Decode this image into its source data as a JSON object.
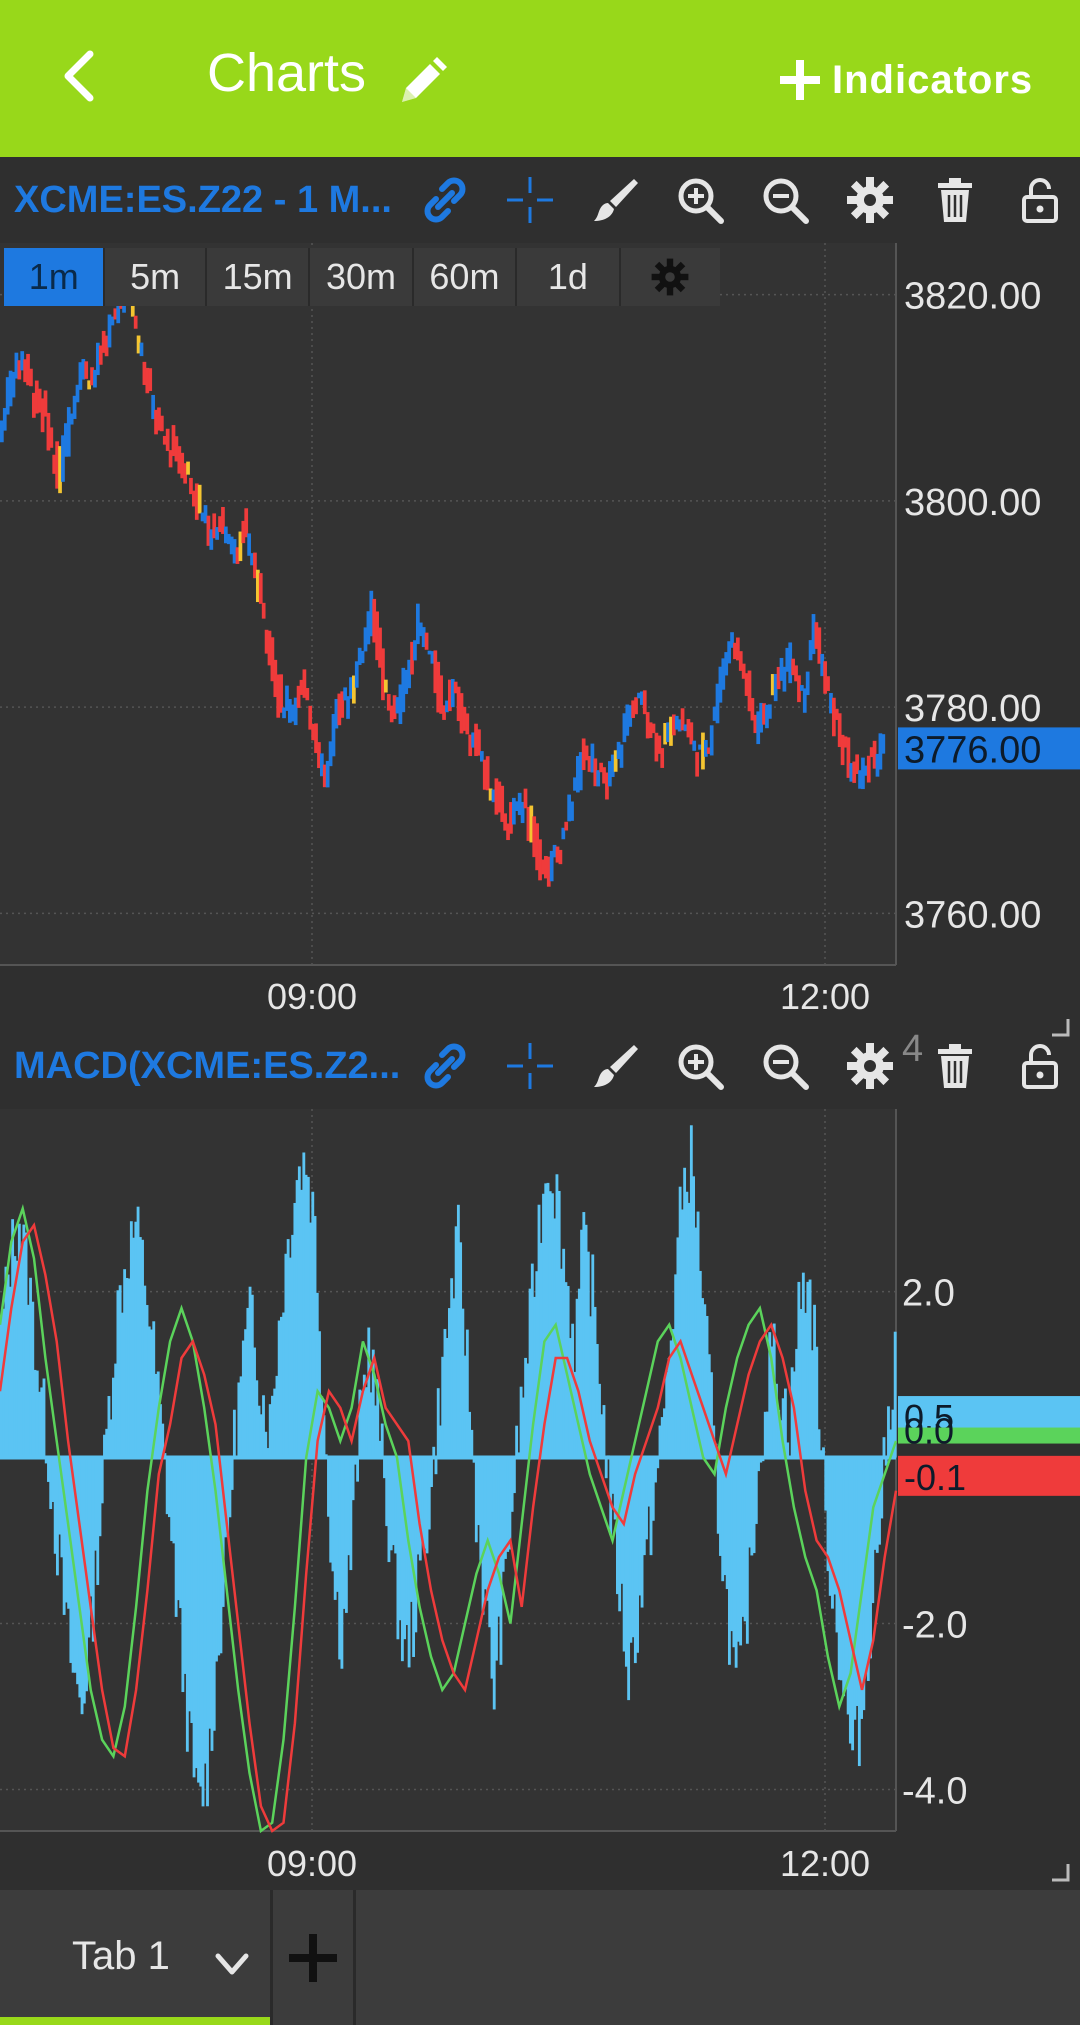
{
  "topbar": {
    "title": "Charts",
    "indicators_label": "Indicators",
    "accent": "#98d81a"
  },
  "price_panel": {
    "title": "XCME:ES.Z22 - 1 M...",
    "timeframes": [
      "1m",
      "5m",
      "15m",
      "30m",
      "60m",
      "1d"
    ],
    "active_timeframe": "1m",
    "y_ticks": [
      "3820.00",
      "3800.00",
      "3780.00",
      "3760.00"
    ],
    "last_price": "3776.00",
    "x_ticks": [
      "09:00",
      "12:00"
    ]
  },
  "macd_panel": {
    "title": "MACD(XCME:ES.Z2...",
    "y_ticks": [
      "2.0",
      "-2.0",
      "-4.0"
    ],
    "top_tick_partial": "4",
    "tag_histogram": "0.5",
    "tag_signal_partial": "0.0",
    "tag_macd": "-0.1",
    "x_ticks": [
      "09:00",
      "12:00"
    ]
  },
  "tabs": {
    "tab1_label": "Tab 1"
  },
  "colors": {
    "up": "#1e79e0",
    "down": "#ef3b3b",
    "doji": "#f4c531",
    "histogram": "#5bc4f3",
    "macd_line": "#ef3b3b",
    "signal_line": "#5bd35b"
  },
  "chart_data": [
    {
      "type": "line",
      "series": [
        {
          "values": [
            3806,
            3812,
            3814,
            3810,
            3808,
            3802,
            3808,
            3813,
            3812,
            3815,
            3818,
            3822,
            3815,
            3810,
            3806,
            3805,
            3803,
            3800,
            3797,
            3798,
            3795,
            3797,
            3793,
            3787,
            3781,
            3780,
            3782,
            3778,
            3773,
            3780,
            3781,
            3785,
            3790,
            3782,
            3779,
            3783,
            3788,
            3785,
            3780,
            3782,
            3778,
            3776,
            3773,
            3770,
            3769,
            3771,
            3767,
            3764,
            3766,
            3770,
            3775,
            3775,
            3772,
            3775,
            3779,
            3781,
            3778,
            3776,
            3779,
            3778,
            3775,
            3777,
            3783,
            3787,
            3783,
            3778,
            3780,
            3783,
            3785,
            3781,
            3788,
            3782,
            3778,
            3774,
            3773,
            3775,
            3776
          ]
        }
      ],
      "ylim": [
        3755,
        3825
      ],
      "x_ticks": [
        "09:00",
        "12:00"
      ]
    },
    {
      "type": "bar",
      "series": [
        {
          "values": [
            1.5,
            2.4,
            2.9,
            2.2,
            1.2,
            0.3,
            -0.8,
            -1.8,
            -2.6,
            -3.0,
            -2.1,
            -0.8,
            0.6,
            1.8,
            2.4,
            2.8,
            2.2,
            1.3,
            0.2,
            -1.0,
            -2.2,
            -3.4,
            -4.2,
            -3.8,
            -2.6,
            -1.4,
            0.2,
            1.2,
            1.8,
            0.8,
            0.4,
            1.6,
            2.6,
            3.4,
            3.6,
            2.8,
            0.6,
            -1.4,
            -2.2,
            -1.2,
            0.4,
            1.4,
            0.6,
            -0.6,
            -1.6,
            -2.4,
            -2.0,
            -1.2,
            -0.4,
            0.8,
            1.8,
            2.6,
            1.2,
            -0.6,
            -1.8,
            -2.8,
            -1.8,
            -0.6,
            0.6,
            1.6,
            2.8,
            3.6,
            3.2,
            2.2,
            1.4,
            2.6,
            2.0,
            0.8,
            -0.6,
            -1.6,
            -2.6,
            -2.0,
            -1.2,
            -0.4,
            0.6,
            1.8,
            3.2,
            3.6,
            2.4,
            1.0,
            -0.6,
            -1.8,
            -2.8,
            -2.2,
            -0.8,
            0.4,
            1.4,
            0.8,
            0.4,
            1.8,
            2.2,
            1.2,
            -0.8,
            -1.8,
            -2.8,
            -3.6,
            -3.2,
            -2.0,
            -0.8,
            0.4,
            1.6
          ]
        }
      ],
      "lines": {
        "macd": [
          0.8,
          1.8,
          2.6,
          2.8,
          2.2,
          1.4,
          0.2,
          -0.8,
          -1.8,
          -2.8,
          -3.5,
          -3.6,
          -2.8,
          -1.6,
          -0.2,
          0.4,
          1.2,
          1.4,
          1.0,
          0.4,
          -0.8,
          -2.0,
          -3.2,
          -4.2,
          -4.6,
          -4.4,
          -3.2,
          -1.4,
          0.2,
          0.8,
          0.6,
          0.2,
          0.8,
          1.2,
          0.6,
          0.4,
          0.2,
          -0.8,
          -1.6,
          -2.2,
          -2.6,
          -2.8,
          -2.2,
          -1.6,
          -1.2,
          -1.0,
          -1.8,
          -0.6,
          0.4,
          1.2,
          1.2,
          0.8,
          0.2,
          -0.2,
          -0.6,
          -0.8,
          -0.2,
          0.2,
          0.6,
          1.2,
          1.4,
          1.0,
          0.6,
          0.2,
          -0.2,
          0.4,
          1.0,
          1.4,
          1.6,
          1.2,
          0.6,
          -0.4,
          -1.0,
          -1.2,
          -1.6,
          -2.2,
          -2.8,
          -2.2,
          -1.2,
          -0.4
        ],
        "signal": [
          1.6,
          2.6,
          3.0,
          2.4,
          1.2,
          0.2,
          -0.8,
          -1.8,
          -2.8,
          -3.4,
          -3.6,
          -3.0,
          -1.8,
          -0.4,
          0.6,
          1.4,
          1.8,
          1.4,
          0.6,
          -0.4,
          -1.6,
          -2.8,
          -3.8,
          -4.6,
          -4.4,
          -3.4,
          -1.8,
          0.0,
          0.8,
          0.6,
          0.2,
          0.6,
          1.4,
          1.0,
          0.4,
          0.0,
          -1.0,
          -1.8,
          -2.4,
          -2.8,
          -2.6,
          -2.0,
          -1.4,
          -1.0,
          -1.4,
          -2.0,
          -0.8,
          0.4,
          1.4,
          1.6,
          1.0,
          0.4,
          -0.2,
          -0.6,
          -1.0,
          -0.4,
          0.2,
          0.8,
          1.4,
          1.6,
          1.2,
          0.6,
          0.0,
          -0.2,
          0.6,
          1.2,
          1.6,
          1.8,
          1.2,
          0.2,
          -0.6,
          -1.2,
          -1.6,
          -2.4,
          -3.0,
          -2.6,
          -1.6,
          -0.6,
          -0.2,
          0.2
        ]
      },
      "ylim": [
        -4.5,
        4.2
      ],
      "y_ticks": [
        2.0,
        -2.0,
        -4.0
      ]
    }
  ]
}
